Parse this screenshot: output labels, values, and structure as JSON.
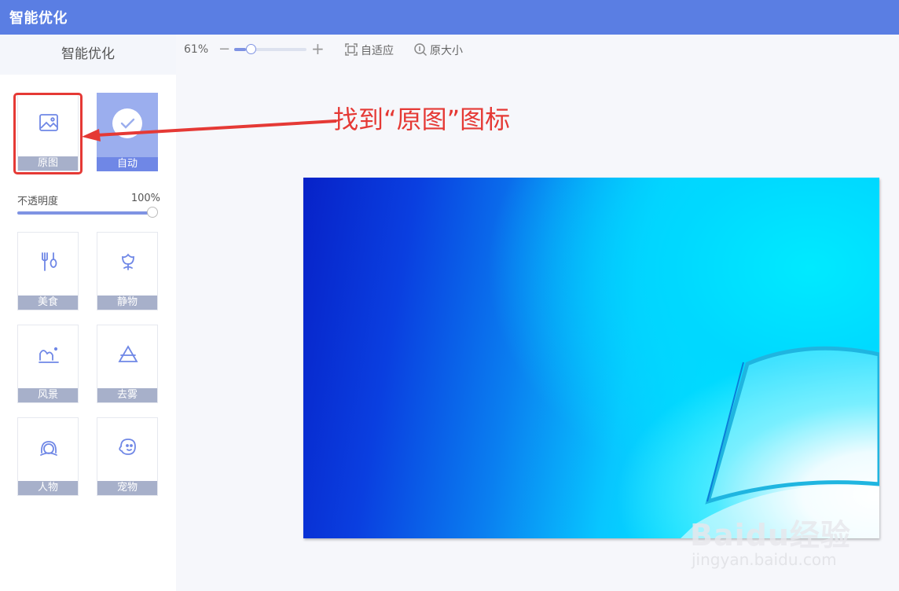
{
  "app": {
    "title": "智能优化"
  },
  "sidebar": {
    "header": "智能优化",
    "tiles": [
      {
        "label": "原图",
        "icon": "image-icon",
        "selected": false
      },
      {
        "label": "自动",
        "icon": "check-circle-icon",
        "selected": true
      },
      {
        "label": "美食",
        "icon": "fork-spoon-icon",
        "selected": false
      },
      {
        "label": "静物",
        "icon": "flower-icon",
        "selected": false
      },
      {
        "label": "风景",
        "icon": "mountain-sun-icon",
        "selected": false
      },
      {
        "label": "去雾",
        "icon": "triangle-haze-icon",
        "selected": false
      },
      {
        "label": "人物",
        "icon": "person-icon",
        "selected": false
      },
      {
        "label": "宠物",
        "icon": "pet-face-icon",
        "selected": false
      }
    ],
    "opacity": {
      "label": "不透明度",
      "value_text": "100%",
      "value": 1.0
    }
  },
  "toolbar": {
    "zoom_text": "61%",
    "zoom_minus": "−",
    "zoom_plus": "+",
    "zoom_value": 0.16,
    "fit_label": "自适应",
    "actual_size_label": "原大小"
  },
  "annotation": {
    "text": "找到“原图”图标",
    "color": "#e53935"
  },
  "watermark": {
    "main": "Baidu经验",
    "sub": "jingyan.baidu.com"
  },
  "colors": {
    "accent": "#5a7ee3",
    "slider": "#7f93e3",
    "highlight": "#e53935"
  }
}
